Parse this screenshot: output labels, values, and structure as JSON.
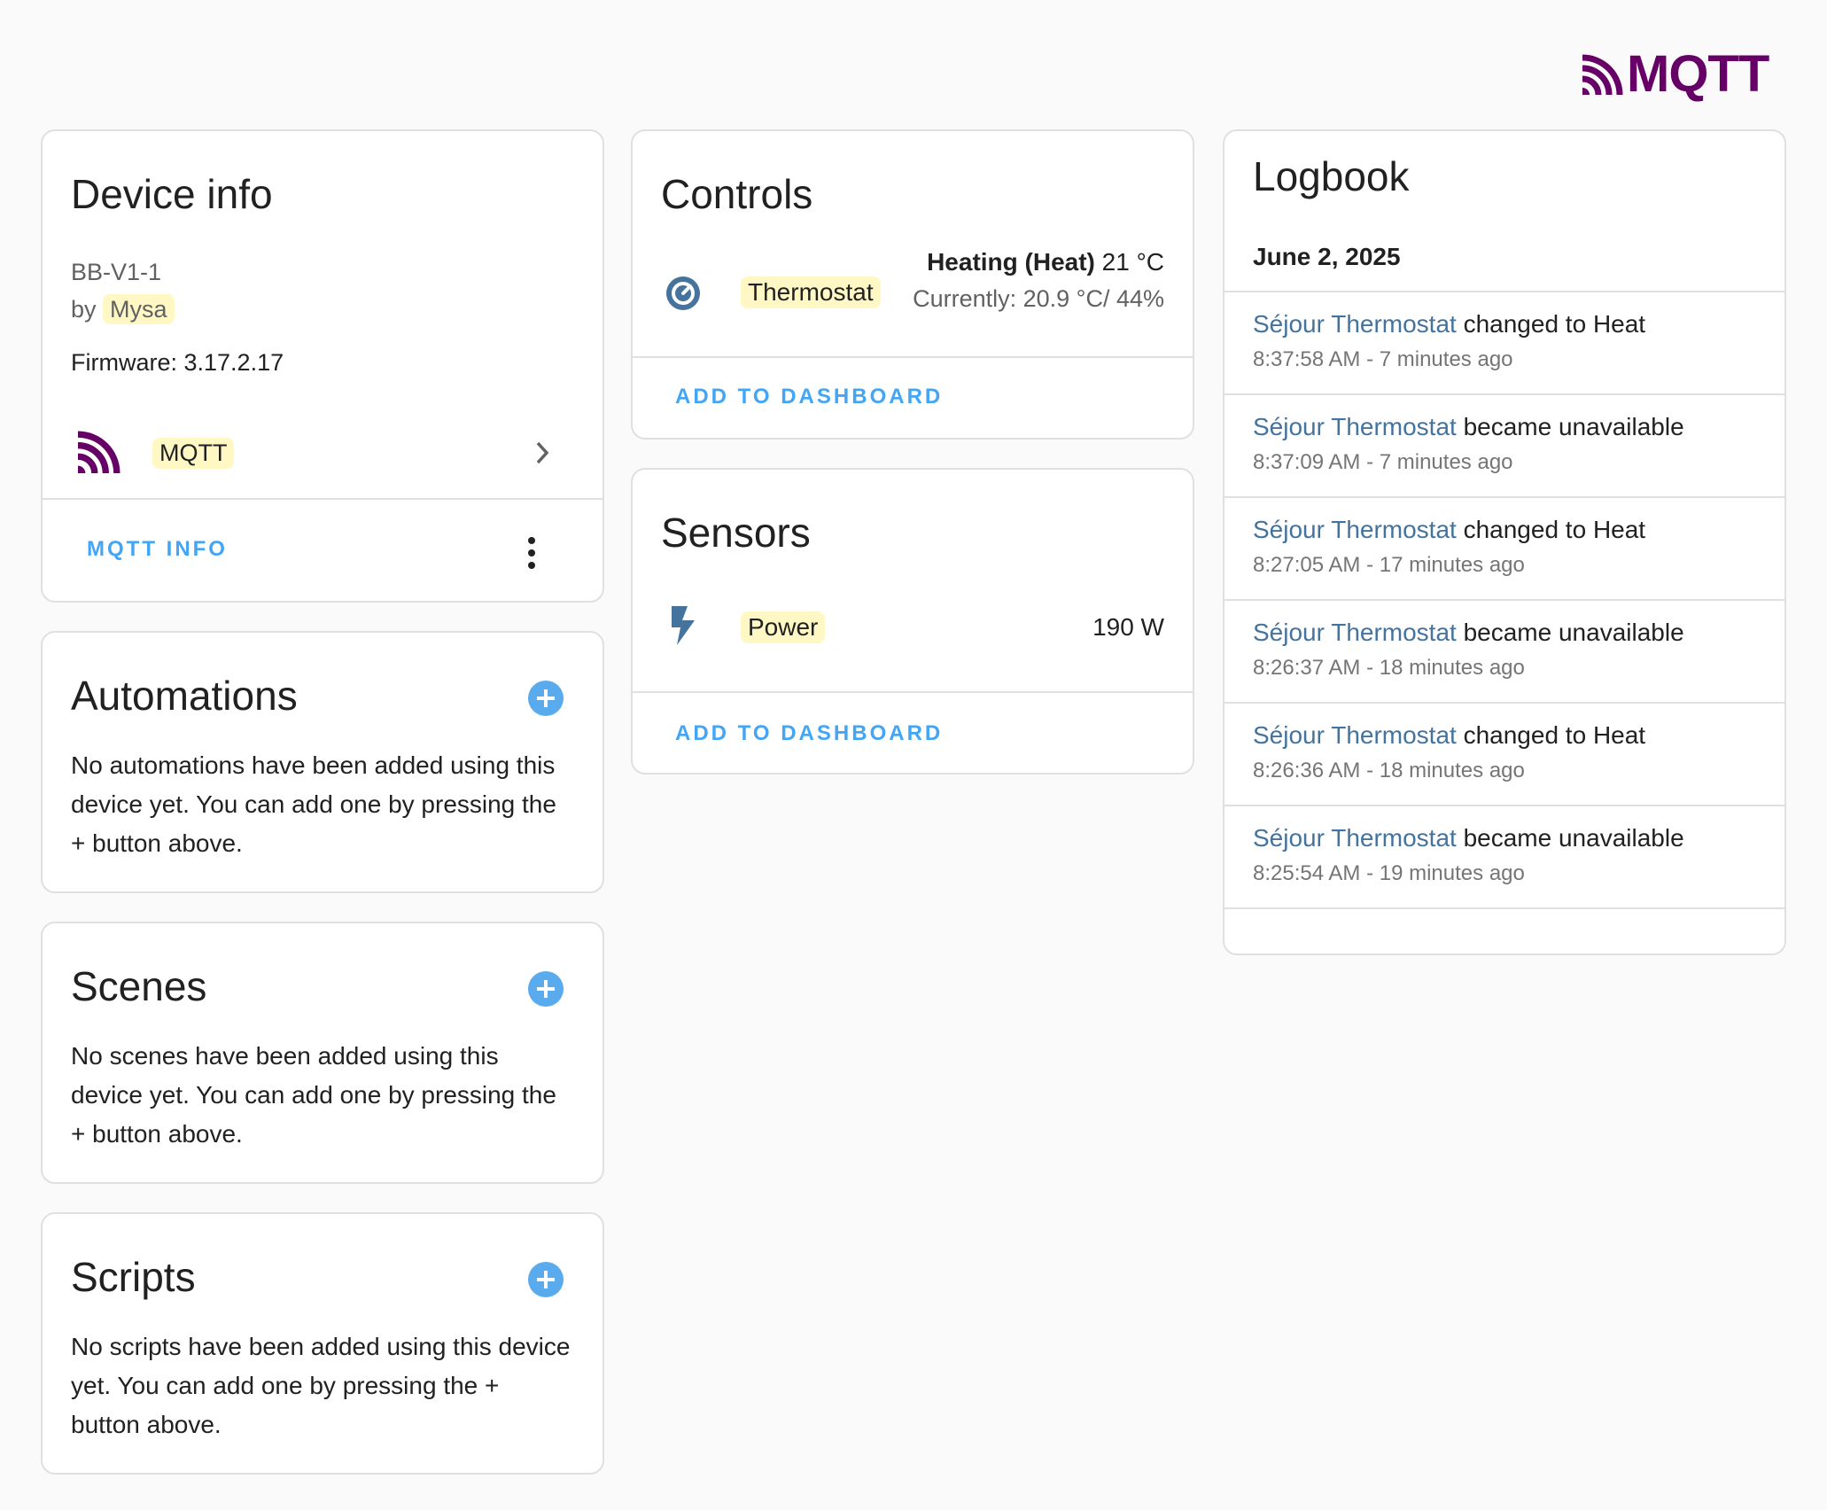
{
  "brand": {
    "logo_text": "MQTT",
    "logo_color": "#660066"
  },
  "device_info": {
    "title": "Device info",
    "model": "BB-V1-1",
    "by_prefix": "by",
    "manufacturer": "Mysa",
    "firmware": "Firmware: 3.17.2.17",
    "integration": "MQTT",
    "action_label": "MQTT INFO"
  },
  "automations": {
    "title": "Automations",
    "empty_text": "No automations have been added using this device yet. You can add one by pressing the + button above."
  },
  "scenes": {
    "title": "Scenes",
    "empty_text": "No scenes have been added using this device yet. You can add one by pressing the + button above."
  },
  "scripts": {
    "title": "Scripts",
    "empty_text": "No scripts have been added using this device yet. You can add one by pressing the + button above."
  },
  "controls": {
    "title": "Controls",
    "entity_name": "Thermostat",
    "state_main": "Heating (Heat)",
    "state_target": "21 °C",
    "state_current": "Currently: 20.9 °C/ 44%",
    "add_label": "ADD TO DASHBOARD"
  },
  "sensors": {
    "title": "Sensors",
    "entity_name": "Power",
    "value": "190 W",
    "add_label": "ADD TO DASHBOARD"
  },
  "logbook": {
    "title": "Logbook",
    "date": "June 2, 2025",
    "entries": [
      {
        "entity": "Séjour Thermostat",
        "action": "changed to Heat",
        "time": "8:37:58 AM - 7 minutes ago"
      },
      {
        "entity": "Séjour Thermostat",
        "action": "became unavailable",
        "time": "8:37:09 AM - 7 minutes ago"
      },
      {
        "entity": "Séjour Thermostat",
        "action": "changed to Heat",
        "time": "8:27:05 AM - 17 minutes ago"
      },
      {
        "entity": "Séjour Thermostat",
        "action": "became unavailable",
        "time": "8:26:37 AM - 18 minutes ago"
      },
      {
        "entity": "Séjour Thermostat",
        "action": "changed to Heat",
        "time": "8:26:36 AM - 18 minutes ago"
      },
      {
        "entity": "Séjour Thermostat",
        "action": "became unavailable",
        "time": "8:25:54 AM - 19 minutes ago"
      }
    ]
  },
  "colors": {
    "accent": "#42a5f5",
    "entity_link": "#44739e",
    "icon": "#44739e",
    "highlight": "#fff8c4"
  }
}
